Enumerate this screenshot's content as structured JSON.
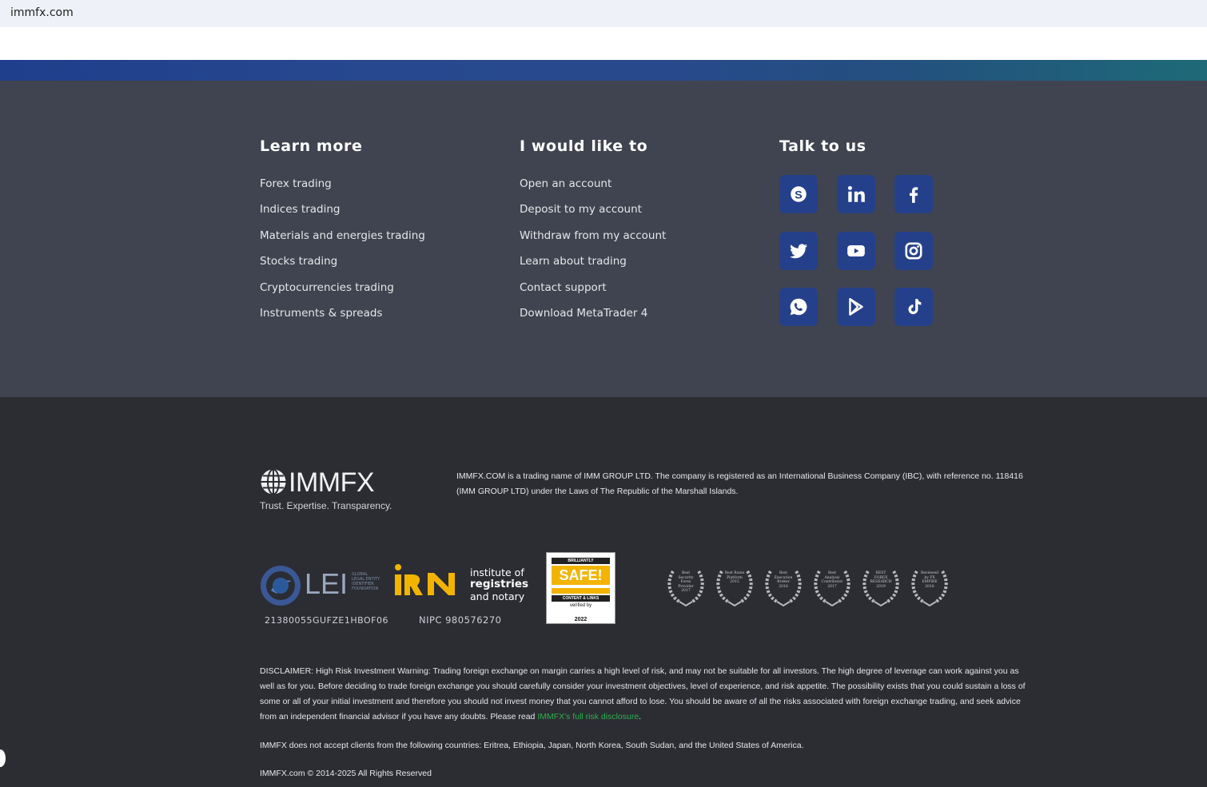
{
  "browser": {
    "url": "immfx.com"
  },
  "columns": [
    {
      "title": "Learn more",
      "links": [
        "Forex trading",
        "Indices trading",
        "Materials and energies trading",
        "Stocks trading",
        "Cryptocurrencies trading",
        "Instruments & spreads"
      ]
    },
    {
      "title": "I would like to",
      "links": [
        "Open an account",
        "Deposit to my account",
        "Withdraw from my account",
        "Learn about trading",
        "Contact support",
        "Download MetaTrader 4"
      ]
    },
    {
      "title": "Talk to us"
    }
  ],
  "social": {
    "button_color": "#25408b",
    "icons": [
      "skype-icon",
      "linkedin-icon",
      "facebook-icon",
      "twitter-icon",
      "youtube-icon",
      "instagram-icon",
      "whatsapp-icon",
      "google-play-icon",
      "tiktok-icon"
    ]
  },
  "brand": {
    "logo_text": "IMMFX",
    "tagline": "Trust. Expertise. Transparency.",
    "company_info": "IMMFX.COM is a trading name of IMM GROUP LTD. The company is registered as an International Business Company (IBC), with reference no. 118416 (IMM GROUP LTD) under the Laws of The Republic of the Marshall Islands."
  },
  "badges": {
    "lei_label": "LEI",
    "lei_small": "GLOBAL LEGAL ENTITY IDENTIFIER FOUNDATION",
    "lei_code": "21380055GUFZE1HBOF06",
    "irn_line1": "institute of",
    "irn_line2": "registries",
    "irn_line3": "and notary",
    "nipc": "NIPC 980576270",
    "safe_top": "BRILLIANTLY",
    "safe_big": "SAFE!",
    "safe_content": "CONTENT & LINKS",
    "safe_verified": "verified by",
    "safe_year": "2022"
  },
  "awards": [
    "Best Security Forex Provider 2017",
    "Best Rates Platform 2015",
    "Best Execution Broker 2016",
    "Best Analysis Contributor 2017",
    "BEST FOREX RESEARCH 2019",
    "Reviewed by FX EMPIRE 2018"
  ],
  "disclaimer": {
    "text": "DISCLAIMER: High Risk Investment Warning: Trading foreign exchange on margin carries a high level of risk, and may not be suitable for all investors. The high degree of leverage can work against you as well as for you. Before deciding to trade foreign exchange you should carefully consider your investment objectives, level of experience, and risk appetite. The possibility exists that you could sustain a loss of some or all of your initial investment and therefore you should not invest money that you cannot afford to lose. You should be aware of all the risks associated with foreign exchange trading, and seek advice from an independent financial advisor if you have any doubts. Please read ",
    "link_text": "IMMFX's full risk disclosure",
    "link_color": "#2bb24c",
    "end": "."
  },
  "countries_notice": "IMMFX does not accept clients from the following countries: Eritrea, Ethiopia, Japan, North Korea, South Sudan, and the United States of America.",
  "copyright": "IMMFX.com © 2014-2025 All Rights Reserved"
}
